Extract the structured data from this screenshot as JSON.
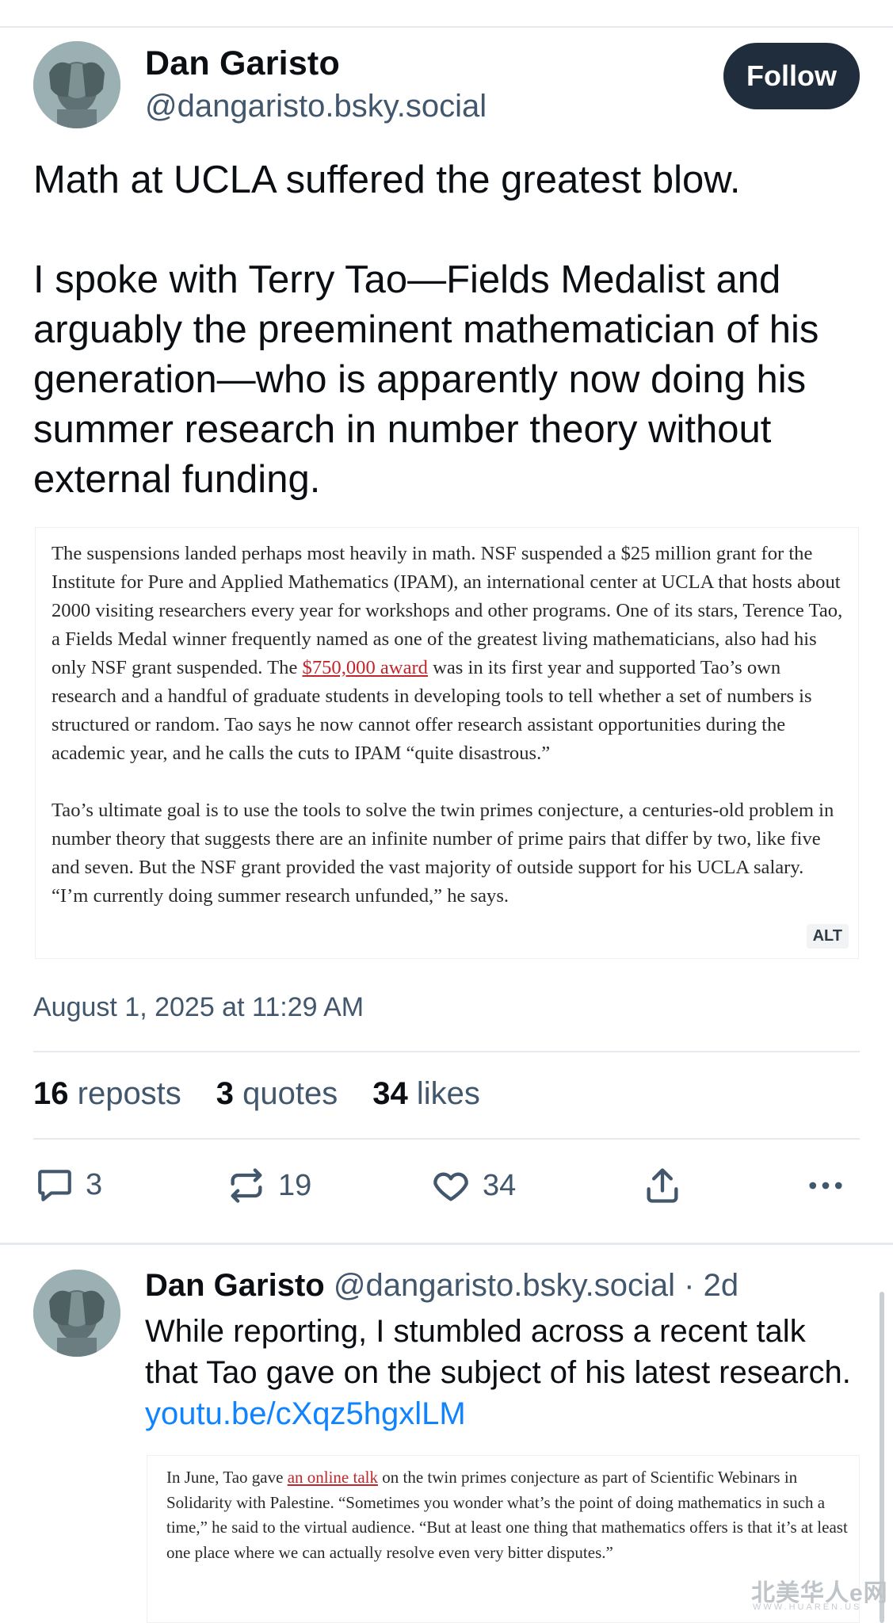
{
  "post": {
    "author_name": "Dan Garisto",
    "author_handle": "@dangaristo.bsky.social",
    "follow_label": "Follow",
    "paragraphs": [
      "Math at UCLA suffered the greatest blow.",
      "I spoke with Terry Tao—Fields Medalist and arguably the preeminent mathematician of his generation—who is apparently now doing his summer research in number theory without external funding."
    ],
    "embed": {
      "para1_before_link": "The suspensions landed perhaps most heavily in math. NSF suspended a $25 million grant for the Institute for Pure and Applied Mathematics (IPAM), an international center at UCLA that hosts about 2000 visiting researchers every year for workshops and other programs. One of its stars, Terence Tao, a Fields Medal winner frequently named as one of the greatest living mathematicians, also had his only NSF grant suspended. The ",
      "para1_link": "$750,000 award",
      "para1_after_link": " was in its first year and supported Tao’s own research and a handful of graduate students in developing tools to tell whether a set of numbers is structured or random. Tao says he now cannot offer research assistant opportunities during the academic year, and he calls the cuts to IPAM “quite disastrous.”",
      "para2": "Tao’s ultimate goal is to use the tools to solve the twin primes conjecture, a centuries-old problem in number theory that suggests there are an infinite number of prime pairs that differ by two, like five and seven. But the NSF grant provided the vast majority of outside support for his UCLA salary. “I’m currently doing summer research unfunded,” he says.",
      "alt_label": "ALT"
    },
    "timestamp": "August 1, 2025 at 11:29 AM",
    "stats": {
      "reposts_count": "16",
      "reposts_label": "reposts",
      "quotes_count": "3",
      "quotes_label": "quotes",
      "likes_count": "34",
      "likes_label": "likes"
    },
    "actions": {
      "reply_count": "3",
      "repost_count": "19",
      "like_count": "34"
    }
  },
  "reply": {
    "author_name": "Dan Garisto",
    "author_handle": "@dangaristo.bsky.social",
    "separator": "·",
    "time_ago": "2d",
    "text": "While reporting, I stumbled across a recent talk that Tao gave on the subject of his latest research.",
    "link": "youtu.be/cXqz5hgxlLM",
    "embed": {
      "before_link": "In June, Tao gave ",
      "link": "an online talk",
      "after_link": " on the twin primes conjecture as part of Scientific Webinars in Solidarity with Palestine. “Sometimes you wonder what’s the point of doing mathematics in such a time,” he said to the virtual audience. “But at least one thing that mathematics offers is that it’s at least one place where we can actually resolve even very bitter disputes.”"
    }
  },
  "watermark": {
    "main": "北美华人e网",
    "sub": "WWW.HUAREN.US"
  },
  "colors": {
    "text_primary": "#0b0f14",
    "text_secondary": "#42576c",
    "follow_bg": "#1f2d3d",
    "link_blue": "#1083fe",
    "link_red": "#c0262b"
  }
}
